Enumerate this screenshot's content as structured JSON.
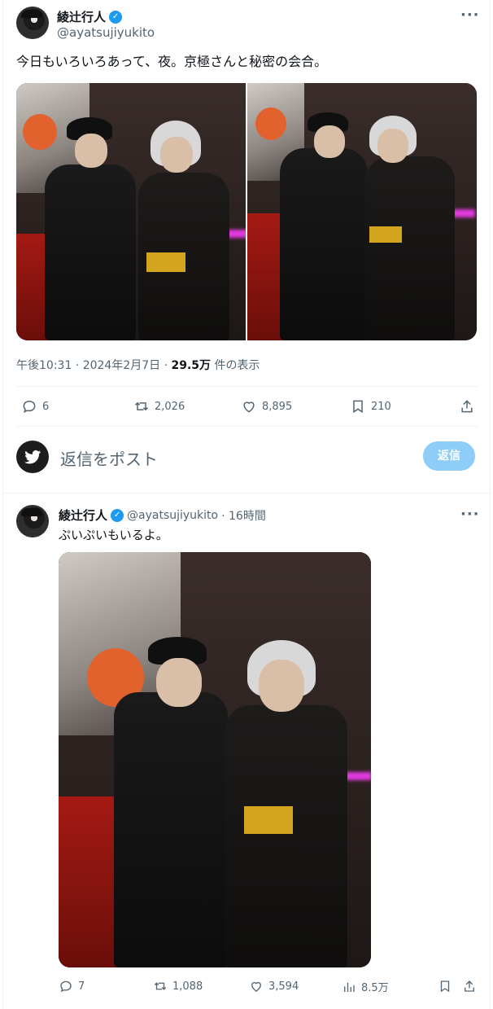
{
  "main_tweet": {
    "author_name": "綾辻行人",
    "handle": "@ayatsujiyukito",
    "text": "今日もいろいろあって、夜。京極さんと秘密の会合。",
    "time": "午後10:31 · 2024年2月7日 · ",
    "views_count": "29.5万",
    "views_label": " 件の表示",
    "replies": "6",
    "reposts": "2,026",
    "likes": "8,895",
    "bookmarks": "210"
  },
  "reply_box": {
    "placeholder": "返信をポスト",
    "button_label": "返信"
  },
  "second_tweet": {
    "author_name": "綾辻行人",
    "handle": "@ayatsujiyukito",
    "time": "· 16時間",
    "text": "ぷいぷいもいるよ。",
    "replies": "7",
    "reposts": "1,088",
    "likes": "3,594",
    "views": "8.5万"
  },
  "colors": {
    "accent": "#1d9bf0",
    "reply_button": "#8ecdf8",
    "muted_text": "#536471"
  },
  "icons": [
    "more-icon",
    "verified-icon",
    "reply-icon",
    "repost-icon",
    "like-icon",
    "bookmark-icon",
    "share-icon",
    "views-icon",
    "twitter-bird-icon"
  ]
}
